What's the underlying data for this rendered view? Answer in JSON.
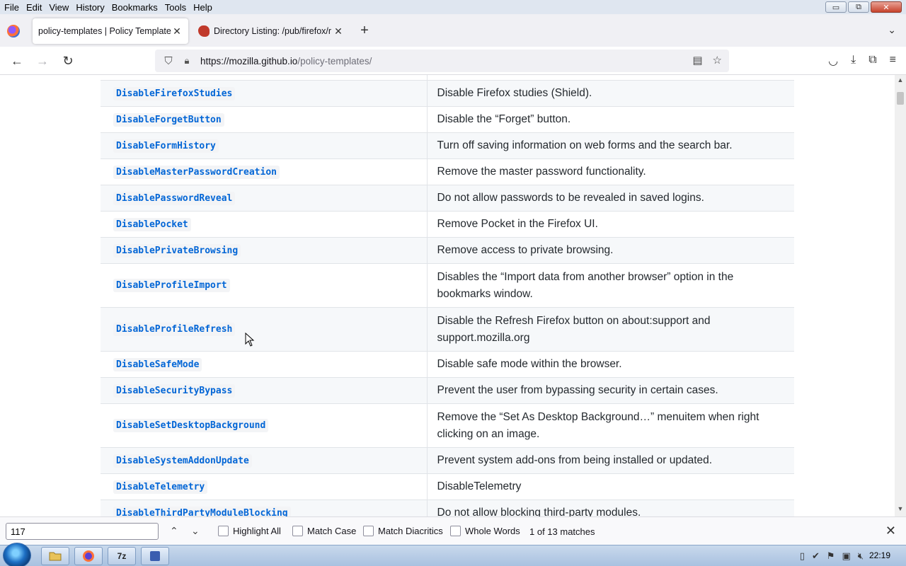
{
  "menu": [
    "File",
    "Edit",
    "View",
    "History",
    "Bookmarks",
    "Tools",
    "Help"
  ],
  "window_controls": {
    "minimize": "▭",
    "restore": "⧉",
    "close": "✕"
  },
  "tabs": [
    {
      "title": "policy-templates | Policy Templates",
      "active": true
    },
    {
      "title": "Directory Listing: /pub/firefox/r",
      "active": false
    }
  ],
  "navbar": {
    "url_host": "https://mozilla.github.io",
    "url_path": "/policy-templates/"
  },
  "policies": [
    {
      "name": "DisableFirefoxStudies",
      "desc": "Disable Firefox studies (Shield)."
    },
    {
      "name": "DisableForgetButton",
      "desc": "Disable the “Forget” button."
    },
    {
      "name": "DisableFormHistory",
      "desc": "Turn off saving information on web forms and the search bar."
    },
    {
      "name": "DisableMasterPasswordCreation",
      "desc": "Remove the master password functionality."
    },
    {
      "name": "DisablePasswordReveal",
      "desc": "Do not allow passwords to be revealed in saved logins."
    },
    {
      "name": "DisablePocket",
      "desc": "Remove Pocket in the Firefox UI."
    },
    {
      "name": "DisablePrivateBrowsing",
      "desc": "Remove access to private browsing."
    },
    {
      "name": "DisableProfileImport",
      "desc": "Disables the “Import data from another browser” option in the bookmarks window."
    },
    {
      "name": "DisableProfileRefresh",
      "desc": "Disable the Refresh Firefox button on about:support and support.mozilla.org"
    },
    {
      "name": "DisableSafeMode",
      "desc": "Disable safe mode within the browser."
    },
    {
      "name": "DisableSecurityBypass",
      "desc": "Prevent the user from bypassing security in certain cases."
    },
    {
      "name": "DisableSetDesktopBackground",
      "desc": "Remove the “Set As Desktop Background…” menuitem when right clicking on an image."
    },
    {
      "name": "DisableSystemAddonUpdate",
      "desc": "Prevent system add-ons from being installed or updated."
    },
    {
      "name": "DisableTelemetry",
      "desc": "DisableTelemetry"
    },
    {
      "name": "DisableThirdPartyModuleBlocking",
      "desc": "Do not allow blocking third-party modules."
    }
  ],
  "findbar": {
    "query": "117",
    "highlight_all": "Highlight All",
    "match_case": "Match Case",
    "match_diacritics": "Match Diacritics",
    "whole_words": "Whole Words",
    "status": "1 of 13 matches"
  },
  "taskbar": {
    "items": [
      "folder-icon",
      "firefox-icon",
      "7z-icon",
      "app-icon"
    ],
    "sevenzip_label": "7z",
    "clock": "22:19"
  }
}
